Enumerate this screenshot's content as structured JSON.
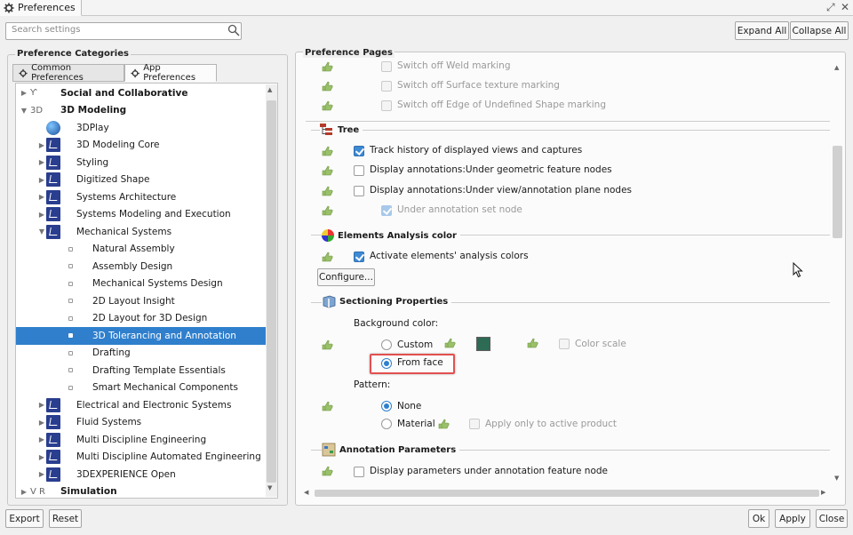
{
  "window": {
    "title": "Preferences"
  },
  "search": {
    "placeholder": "Search settings"
  },
  "toolbar": {
    "expand_all": "Expand All",
    "collapse_all": "Collapse All"
  },
  "categories": {
    "group_title": "Preference Categories",
    "tabs": [
      {
        "label": "Common Preferences"
      },
      {
        "label": "App Preferences",
        "active": true
      }
    ],
    "tree": [
      {
        "label": "Social and Collaborative",
        "level": 0,
        "expander": "right",
        "icon": "social-collab-icon",
        "bold": true
      },
      {
        "label": "3D Modeling",
        "level": 0,
        "expander": "down",
        "icon": "3d-text-icon",
        "bold": true
      },
      {
        "label": "3DPlay",
        "level": 1,
        "expander": "none",
        "icon": "3dplay-icon"
      },
      {
        "label": "3D Modeling Core",
        "level": 1,
        "expander": "right",
        "icon": "app-icon"
      },
      {
        "label": "Styling",
        "level": 1,
        "expander": "right",
        "icon": "app-icon"
      },
      {
        "label": "Digitized Shape",
        "level": 1,
        "expander": "right",
        "icon": "app-icon"
      },
      {
        "label": "Systems Architecture",
        "level": 1,
        "expander": "right",
        "icon": "app-icon"
      },
      {
        "label": "Systems Modeling and Execution",
        "level": 1,
        "expander": "right",
        "icon": "app-icon"
      },
      {
        "label": "Mechanical Systems",
        "level": 1,
        "expander": "down",
        "icon": "app-icon"
      },
      {
        "label": "Natural Assembly",
        "level": 2,
        "expander": "none",
        "icon": "bullet"
      },
      {
        "label": "Assembly Design",
        "level": 2,
        "expander": "none",
        "icon": "bullet"
      },
      {
        "label": "Mechanical Systems Design",
        "level": 2,
        "expander": "none",
        "icon": "bullet"
      },
      {
        "label": "2D Layout Insight",
        "level": 2,
        "expander": "none",
        "icon": "bullet"
      },
      {
        "label": "2D Layout for 3D Design",
        "level": 2,
        "expander": "none",
        "icon": "bullet"
      },
      {
        "label": "3D Tolerancing and Annotation",
        "level": 2,
        "expander": "none",
        "icon": "bullet",
        "selected": true
      },
      {
        "label": "Drafting",
        "level": 2,
        "expander": "none",
        "icon": "bullet"
      },
      {
        "label": "Drafting Template Essentials",
        "level": 2,
        "expander": "none",
        "icon": "bullet"
      },
      {
        "label": "Smart Mechanical Components",
        "level": 2,
        "expander": "none",
        "icon": "bullet"
      },
      {
        "label": "Electrical and Electronic Systems",
        "level": 1,
        "expander": "right",
        "icon": "app-icon"
      },
      {
        "label": "Fluid Systems",
        "level": 1,
        "expander": "right",
        "icon": "app-icon"
      },
      {
        "label": "Multi Discipline Engineering",
        "level": 1,
        "expander": "right",
        "icon": "app-icon"
      },
      {
        "label": "Multi Discipline Automated Engineering",
        "level": 1,
        "expander": "right",
        "icon": "app-icon"
      },
      {
        "label": "3DEXPERIENCE Open",
        "level": 1,
        "expander": "right",
        "icon": "app-icon"
      },
      {
        "label": "Simulation",
        "level": 0,
        "expander": "right",
        "icon": "vr-text-icon",
        "bold": true
      }
    ]
  },
  "pages": {
    "group_title": "Preference Pages",
    "weld_rows": [
      {
        "label": "Switch off Weld marking"
      },
      {
        "label": "Switch off Surface texture marking"
      },
      {
        "label": "Switch off Edge of Undefined Shape marking"
      }
    ],
    "tree_section": {
      "title": "Tree",
      "options": [
        {
          "label": "Track history of displayed views and captures",
          "checked": true
        },
        {
          "label": "Display annotations:Under geometric feature nodes",
          "checked": false
        },
        {
          "label": "Display annotations:Under view/annotation plane nodes",
          "checked": false
        },
        {
          "label": "Under annotation set node",
          "checked": true,
          "disabled": true
        }
      ]
    },
    "elements_section": {
      "title": "Elements Analysis color",
      "option": {
        "label": "Activate elements' analysis colors",
        "checked": true
      },
      "configure_button": "Configure..."
    },
    "sectioning": {
      "title": "Sectioning Properties",
      "bg_label": "Background color:",
      "custom_label": "Custom",
      "swatch_color": "#2e6b55",
      "color_scale_label": "Color scale",
      "from_face_label": "From face",
      "pattern_label": "Pattern:",
      "none_label": "None",
      "material_label": "Material",
      "apply_active_label": "Apply only to active product"
    },
    "annotation_params": {
      "title": "Annotation Parameters",
      "option": {
        "label": "Display parameters under annotation feature node",
        "checked": false
      }
    }
  },
  "footer": {
    "export": "Export",
    "reset": "Reset",
    "ok": "Ok",
    "apply": "Apply",
    "close": "Close"
  },
  "icons": {
    "license": "license-hand-icon"
  }
}
